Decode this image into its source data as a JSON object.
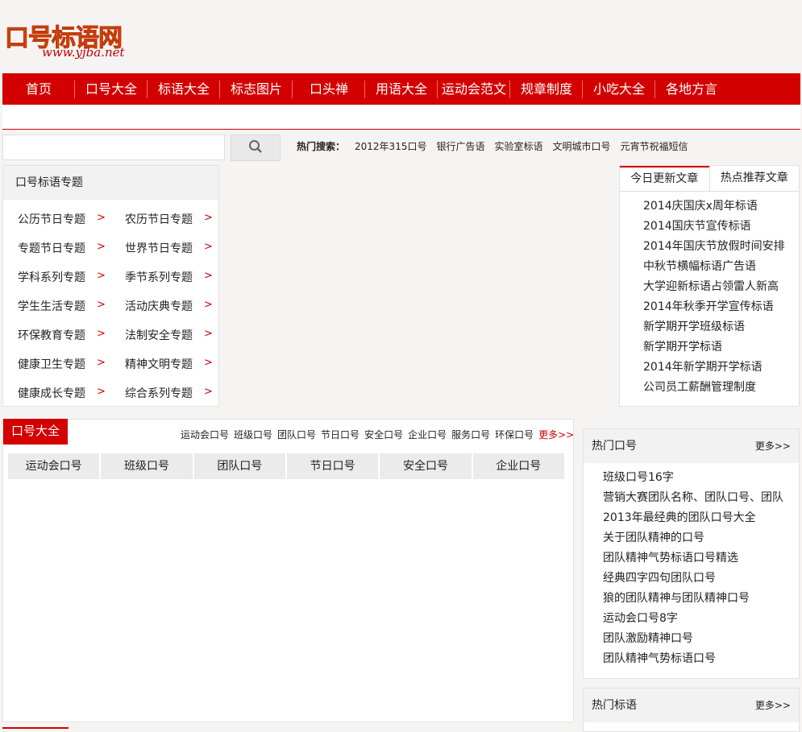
{
  "logo": {
    "text": "口号标语网",
    "url": "www.yjba.net"
  },
  "nav": [
    "首页",
    "口号大全",
    "标语大全",
    "标志图片",
    "口头禅",
    "用语大全",
    "运动会范文",
    "规章制度",
    "小吃大全",
    "各地方言"
  ],
  "search": {
    "value": "",
    "hot_label": "热门搜索：",
    "hot_terms": [
      "2012年315口号",
      "银行广告语",
      "实验室标语",
      "文明城市口号",
      "元宵节祝福短信"
    ]
  },
  "topics": {
    "title": "口号标语专题",
    "items": [
      "公历节日专题",
      "农历节日专题",
      "专题节日专题",
      "世界节日专题",
      "学科系列专题",
      "季节系列专题",
      "学生生活专题",
      "活动庆典专题",
      "环保教育专题",
      "法制安全专题",
      "健康卫生专题",
      "精神文明专题",
      "健康成长专题",
      "综合系列专题"
    ]
  },
  "articles": {
    "tabs": [
      "今日更新文章",
      "热点推荐文章"
    ],
    "items": [
      "2014庆国庆x周年标语",
      "2014国庆节宣传标语",
      "2014年国庆节放假时间安排",
      "中秋节横幅标语广告语",
      "大学迎新标语占领雷人新高",
      "2014年秋季开学宣传标语",
      "新学期开学班级标语",
      "新学期开学标语",
      "2014年新学期开学标语",
      "公司员工薪酬管理制度"
    ]
  },
  "kouhao": {
    "title": "口号大全",
    "links": [
      "运动会口号",
      "班级口号",
      "团队口号",
      "节日口号",
      "安全口号",
      "企业口号",
      "服务口号",
      "环保口号"
    ],
    "more": "更多>>",
    "tabs": [
      "运动会口号",
      "班级口号",
      "团队口号",
      "节日口号",
      "安全口号",
      "企业口号"
    ]
  },
  "hot_kouhao": {
    "title": "热门口号",
    "more": "更多>>",
    "items": [
      "班级口号16字",
      "营销大赛团队名称、团队口号、团队",
      "2013年最经典的团队口号大全",
      "关于团队精神的口号",
      "团队精神气势标语口号精选",
      "经典四字四句团队口号",
      "狼的团队精神与团队精神口号",
      "运动会口号8字",
      "团队激励精神口号",
      "团队精神气势标语口号"
    ]
  },
  "hot_biaoyu": {
    "title": "热门标语",
    "more": "更多>>"
  },
  "colors": {
    "brand_red": "#d30000",
    "logo_orange": "#f26522"
  }
}
